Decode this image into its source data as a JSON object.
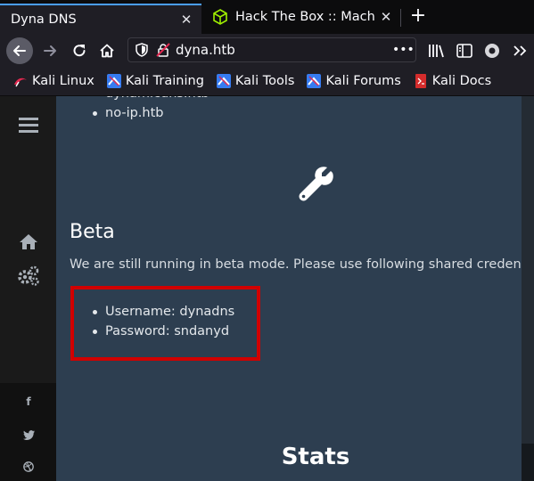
{
  "browser": {
    "tabs": [
      {
        "title": "Dyna DNS",
        "active": true,
        "close": "✕"
      },
      {
        "title": "Hack The Box :: Machines",
        "active": false,
        "close": "✕"
      }
    ],
    "new_tab": "+",
    "url": "dyna.htb",
    "bookmarks": [
      {
        "label": "Kali Linux",
        "icon": "kali-logo-icon"
      },
      {
        "label": "Kali Training",
        "icon": "kali-training-icon"
      },
      {
        "label": "Kali Tools",
        "icon": "kali-tools-icon"
      },
      {
        "label": "Kali Forums",
        "icon": "kali-forums-icon"
      },
      {
        "label": "Kali Docs",
        "icon": "kali-docs-icon"
      }
    ]
  },
  "page": {
    "domains_partial": "dynamicdns.htb",
    "domains": [
      "no-ip.htb"
    ],
    "beta_title": "Beta",
    "beta_text": "We are still running in beta mode. Please use following shared credentials:",
    "credentials": [
      "Username: dynadns",
      "Password: sndanyd"
    ],
    "stats_title": "Stats"
  },
  "sidebar": {
    "icons": [
      "menu-icon",
      "home-icon",
      "settings-icon",
      "facebook-icon",
      "twitter-icon",
      "dribbble-icon"
    ],
    "facebook_glyph": "f"
  },
  "colors": {
    "page_bg": "#2d3e50",
    "sidebar_bg": "#1a1a1a",
    "highlight": "#d10000",
    "tab_accent": "#4a9df8"
  }
}
